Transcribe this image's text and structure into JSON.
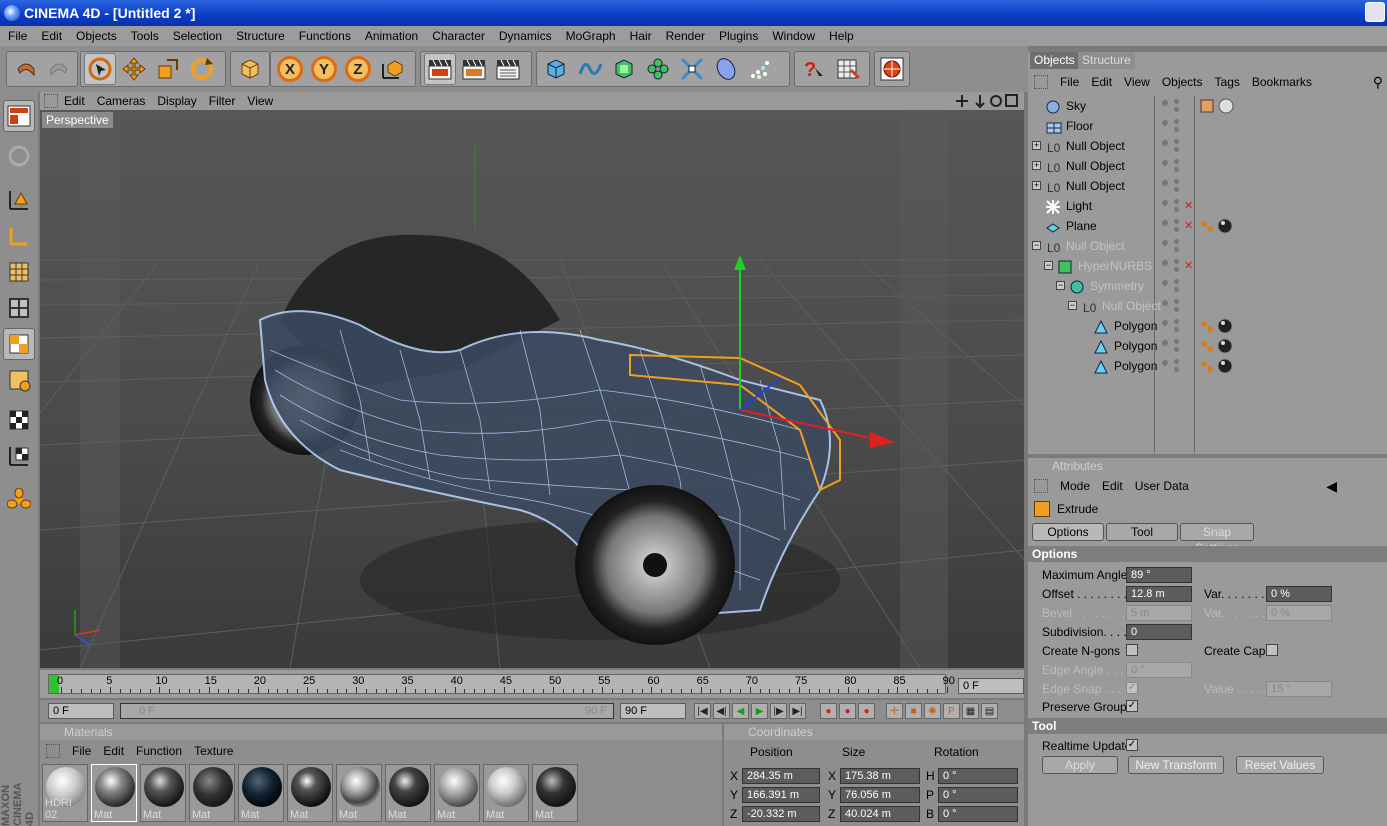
{
  "window": {
    "title": "CINEMA 4D - [Untitled 2 *]"
  },
  "menu": [
    "File",
    "Edit",
    "Objects",
    "Tools",
    "Selection",
    "Structure",
    "Functions",
    "Animation",
    "Character",
    "Dynamics",
    "MoGraph",
    "Hair",
    "Render",
    "Plugins",
    "Window",
    "Help"
  ],
  "toolbar": {
    "axis_x": "X",
    "axis_y": "Y",
    "axis_z": "Z"
  },
  "viewport": {
    "menu": [
      "Edit",
      "Cameras",
      "Display",
      "Filter",
      "View"
    ],
    "label": "Perspective"
  },
  "timeline": {
    "ticks": [
      "0",
      "5",
      "10",
      "15",
      "20",
      "25",
      "30",
      "35",
      "40",
      "45",
      "50",
      "55",
      "60",
      "65",
      "70",
      "75",
      "80",
      "85",
      "90"
    ],
    "end_field": "0 F",
    "current_field": "0 F",
    "range_start": "0 F",
    "range_end": "90 F",
    "max_field": "90 F"
  },
  "materials": {
    "title": "Materials",
    "menu": [
      "File",
      "Edit",
      "Function",
      "Texture"
    ],
    "items": [
      "HDRI 02",
      "Mat",
      "Mat",
      "Mat",
      "Mat",
      "Mat",
      "Mat",
      "Mat",
      "Mat",
      "Mat",
      "Mat"
    ],
    "side_label": "MAXON CINEMA 4D"
  },
  "coordinates": {
    "title": "Coordinates",
    "headers": [
      "Position",
      "Size",
      "Rotation"
    ],
    "rows": [
      {
        "axis": "X",
        "pos": "284.35 m",
        "size_axis": "X",
        "size": "175.38 m",
        "rot_axis": "H",
        "rot": "0 °"
      },
      {
        "axis": "Y",
        "pos": "166.391 m",
        "size_axis": "Y",
        "size": "76.056 m",
        "rot_axis": "P",
        "rot": "0 °"
      },
      {
        "axis": "Z",
        "pos": "-20.332 m",
        "size_axis": "Z",
        "size": "40.024 m",
        "rot_axis": "B",
        "rot": "0 °"
      }
    ]
  },
  "objects_panel": {
    "tabs": [
      "Objects",
      "Structure"
    ],
    "menu": [
      "File",
      "Edit",
      "View",
      "Objects",
      "Tags",
      "Bookmarks"
    ],
    "items": [
      {
        "name": "Sky",
        "indent": 0,
        "dim": false
      },
      {
        "name": "Floor",
        "indent": 0,
        "dim": false
      },
      {
        "name": "Null Object",
        "indent": 0,
        "dim": false
      },
      {
        "name": "Null Object",
        "indent": 0,
        "dim": false
      },
      {
        "name": "Null Object",
        "indent": 0,
        "dim": false
      },
      {
        "name": "Light",
        "indent": 0,
        "dim": false
      },
      {
        "name": "Plane",
        "indent": 0,
        "dim": false
      },
      {
        "name": "Null Object",
        "indent": 0,
        "dim": true
      },
      {
        "name": "HyperNURBS",
        "indent": 1,
        "dim": true
      },
      {
        "name": "Symmetry",
        "indent": 2,
        "dim": true
      },
      {
        "name": "Null Object",
        "indent": 3,
        "dim": true
      },
      {
        "name": "Polygon",
        "indent": 4,
        "dim": false
      },
      {
        "name": "Polygon",
        "indent": 4,
        "dim": false
      },
      {
        "name": "Polygon",
        "indent": 4,
        "dim": false
      }
    ]
  },
  "attributes": {
    "title": "Attributes",
    "menu": [
      "Mode",
      "Edit",
      "User Data"
    ],
    "tool_name": "Extrude",
    "tabs": [
      "Options",
      "Tool",
      "Snap Settings"
    ],
    "options_header": "Options",
    "max_angle_label": "Maximum Angle",
    "max_angle": "89 °",
    "offset_label": "Offset . . . . . . . .",
    "offset": "12.8 m",
    "var_label": "Var. . . . . . .",
    "offset_var": "0 %",
    "bevel_label": "Bevel . . . . . . . .",
    "bevel": "5 m",
    "bevel_var": "0 %",
    "subdivision_label": "Subdivision. . . . .",
    "subdivision": "0",
    "create_ngons_label": "Create N-gons",
    "create_caps_label": "Create Caps",
    "edge_angle_label": "Edge Angle . . . .",
    "edge_angle": "0 °",
    "edge_snap_label": "Edge Snap . . . .",
    "value_label": "Value . . . . .",
    "edge_value": "15 °",
    "preserve_groups_label": "Preserve Groups",
    "tool_header": "Tool",
    "realtime_update_label": "Realtime Update",
    "apply_label": "Apply",
    "new_transform_label": "New Transform",
    "reset_values_label": "Reset Values"
  }
}
